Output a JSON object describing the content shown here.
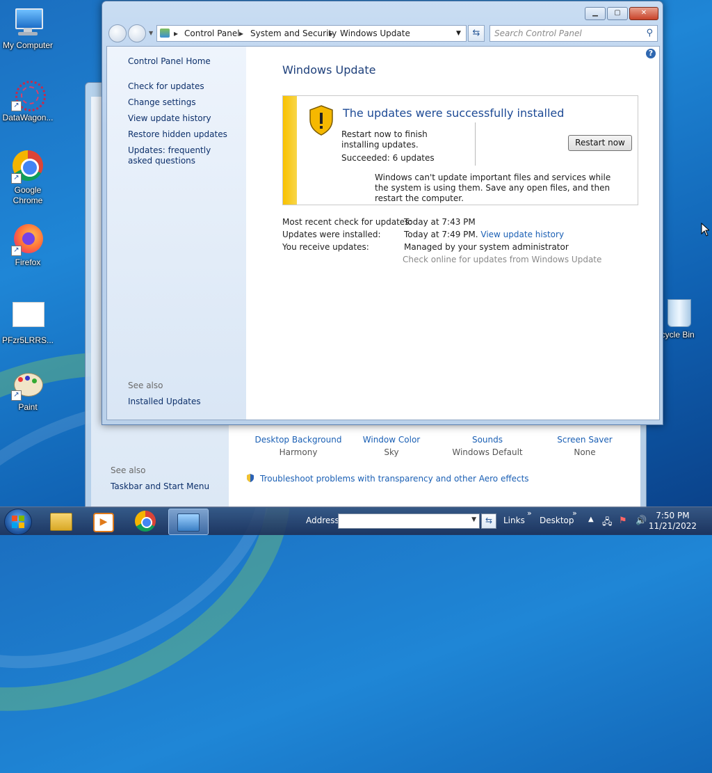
{
  "desktop": {
    "icons": [
      {
        "label": "My Computer"
      },
      {
        "label": "DataWagon..."
      },
      {
        "label": "Google Chrome"
      },
      {
        "label": "Firefox"
      },
      {
        "label": "PFzr5LRRS..."
      },
      {
        "label": "Paint"
      },
      {
        "label": "ecycle Bin"
      }
    ]
  },
  "background_window": {
    "items": [
      {
        "title": "Desktop Background",
        "sub": "Harmony"
      },
      {
        "title": "Window Color",
        "sub": "Sky"
      },
      {
        "title": "Sounds",
        "sub": "Windows Default"
      },
      {
        "title": "Screen Saver",
        "sub": "None"
      }
    ],
    "see_also": "See also",
    "taskbar_link": "Taskbar and Start Menu",
    "troubleshoot": "Troubleshoot problems with transparency and other Aero effects"
  },
  "window": {
    "breadcrumb": [
      "Control Panel",
      "System and Security",
      "Windows Update"
    ],
    "search_placeholder": "Search Control Panel",
    "sidebar": {
      "home": "Control Panel Home",
      "links": [
        "Check for updates",
        "Change settings",
        "View update history",
        "Restore hidden updates",
        "Updates: frequently asked questions"
      ],
      "see_also": "See also",
      "installed_updates": "Installed Updates"
    },
    "title": "Windows Update",
    "status": {
      "heading": "The updates were successfully installed",
      "restart_msg": "Restart now to finish installing updates.",
      "succeeded": "Succeeded: 6 updates",
      "button": "Restart now",
      "note": "Windows can't update important files and services while the system is using them. Save any open files, and then restart the computer."
    },
    "info": {
      "recent_label": "Most recent check for updates:",
      "recent_value": "Today at 7:43 PM",
      "installed_label": "Updates were installed:",
      "installed_value": "Today at 7:49 PM.",
      "history_link": "View update history",
      "receive_label": "You receive updates:",
      "receive_value": "Managed by your system administrator",
      "check_online": "Check online for updates from Windows Update"
    }
  },
  "taskbar": {
    "address_label": "Address",
    "links": "Links",
    "desktop": "Desktop",
    "time": "7:50 PM",
    "date": "11/21/2022"
  }
}
